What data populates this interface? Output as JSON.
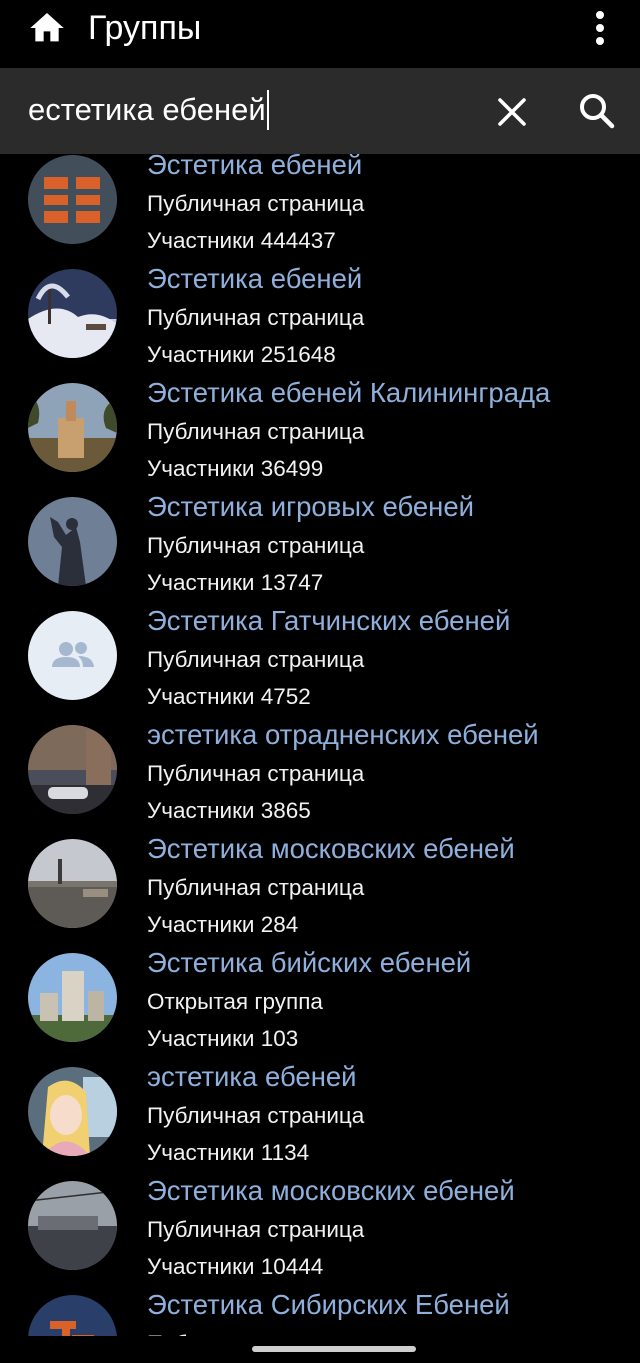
{
  "header": {
    "title": "Группы",
    "home_icon": "home-icon",
    "menu_icon": "more-vertical-icon"
  },
  "search": {
    "value": "естетика ебеней",
    "clear_icon": "close-icon",
    "search_icon": "search-icon"
  },
  "groups": [
    {
      "name": "Эстетика ебеней",
      "type": "Публичная страница",
      "members": "Участники 444437"
    },
    {
      "name": "Эстетика ебеней",
      "type": "Публичная страница",
      "members": "Участники 251648"
    },
    {
      "name": "Эстетика ебеней Калининграда",
      "type": "Публичная страница",
      "members": "Участники 36499"
    },
    {
      "name": "Эстетика игровых ебеней",
      "type": "Публичная страница",
      "members": "Участники 13747"
    },
    {
      "name": "Эстетика Гатчинских ебеней",
      "type": "Публичная страница",
      "members": "Участники 4752"
    },
    {
      "name": "эстетика отрадненских ебеней",
      "type": "Публичная страница",
      "members": "Участники 3865"
    },
    {
      "name": "Эстетика московских ебеней",
      "type": "Публичная страница",
      "members": "Участники 284"
    },
    {
      "name": "Эстетика бийских ебеней",
      "type": "Открытая группа",
      "members": "Участники 103"
    },
    {
      "name": "эстетика ебеней",
      "type": "Публичная страница",
      "members": "Участники 1134"
    },
    {
      "name": "Эстетика московских ебеней",
      "type": "Публичная страница",
      "members": "Участники 10444"
    },
    {
      "name": "Эстетика Сибирских Ебеней",
      "type": "Публичная страница",
      "members": ""
    }
  ],
  "colors": {
    "background": "#000000",
    "search_bar": "#2b2b2b",
    "group_name": "#8fb0dc",
    "text": "#f2f2f2"
  }
}
